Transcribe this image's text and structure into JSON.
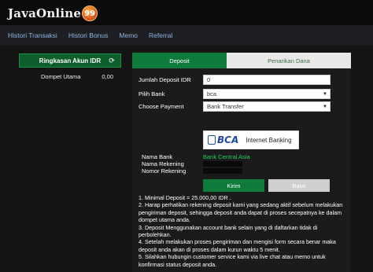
{
  "logo": {
    "text": "JavaOnline",
    "badge": "99"
  },
  "nav": {
    "items": [
      "Histori Transaksi",
      "Histori Bonus",
      "Memo",
      "Referral"
    ]
  },
  "sidebar": {
    "title": "Ringkasan Akun IDR",
    "refresh_icon": "refresh-icon",
    "rows": [
      {
        "label": "Dompet Utama",
        "value": "0,00"
      }
    ]
  },
  "tabs": {
    "deposit": "Deposit",
    "withdraw": "Penarikan Dana"
  },
  "form": {
    "amount_label": "Jumlah Deposit IDR",
    "amount_value": "0",
    "bank_label": "Pilih Bank",
    "bank_value": "bca",
    "payment_label": "Choose Payment",
    "payment_value": "Bank Transfer",
    "bank_card": {
      "logo_text": "BCA",
      "type": "Internet Banking"
    },
    "bank_name_label": "Nama Bank",
    "bank_name_value": "Bank Central Asia",
    "account_name_label": "Nama Rekening",
    "account_number_label": "Nomor Rekening",
    "submit_label": "Kirim",
    "cancel_label": "Batal"
  },
  "notes": [
    "1. Minimal Deposit = 25.000,00 IDR .",
    "2. Harap perhatikan rekening deposit kami yang sedang aktif sebelum melakukan",
    "pengiriman deposit, sehingga deposit anda dapat di proses secepatnya ke dalam",
    "dompet utama anda.",
    "3. Deposit Menggunakan account bank selain yang di daftarkan tidak di",
    "perbolehkan.",
    "4. Setelah melakukan proses pengiriman dan mengisi form secara benar maka",
    "deposit anda akan di proses dalam kurun waktu 5 menit.",
    "5. Silahkan hubungin customer service kami via live chat atau memo untuk",
    "konfirmasi status deposit anda."
  ],
  "colors": {
    "accent_green": "#0e7b3b",
    "bank_name_green": "#1bd35b",
    "bca_blue": "#1f4aa0"
  }
}
